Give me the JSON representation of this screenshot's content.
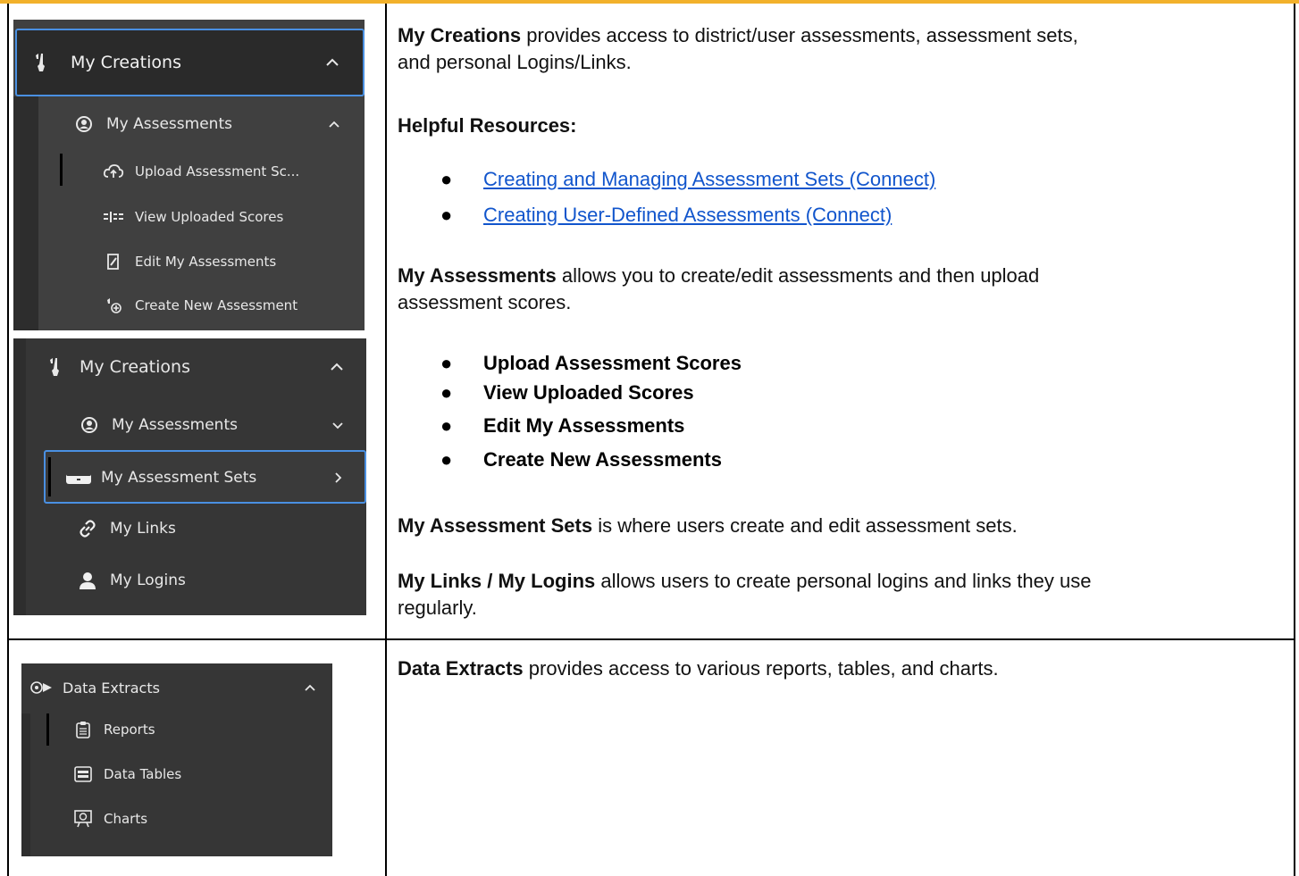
{
  "shot1": {
    "header": "My Creations",
    "header_icon": "tools-icon",
    "group": "My Assessments",
    "items": [
      {
        "label": "Upload Assessment Sc...",
        "icon": "cloud-upload-icon"
      },
      {
        "label": "View Uploaded Scores",
        "icon": "list-icon"
      },
      {
        "label": "Edit My Assessments",
        "icon": "edit-icon"
      },
      {
        "label": "Create New Assessment",
        "icon": "create-icon"
      }
    ]
  },
  "shot2": {
    "header": "My Creations",
    "items": [
      {
        "label": "My Assessments"
      },
      {
        "label": "My Assessment Sets"
      },
      {
        "label": "My Links"
      },
      {
        "label": "My Logins"
      }
    ]
  },
  "shot3": {
    "header": "Data Extracts",
    "items": [
      {
        "label": "Reports"
      },
      {
        "label": "Data Tables"
      },
      {
        "label": "Charts"
      }
    ]
  },
  "content": {
    "p1_bold": "My Creations",
    "p1_rest": " provides access to district/user assessments, assessment sets,",
    "p1_line2": "and personal Logins/Links.",
    "resources_heading": "Helpful Resources:",
    "links": [
      "Creating and Managing Assessment Sets (Connect)",
      "Creating User-Defined Assessments (Connect)"
    ],
    "p2_bold": "My Assessments",
    "p2_rest": " allows you to create/edit assessments and then upload",
    "p2_line2": "assessment scores.",
    "assessment_bullets": [
      "Upload Assessment Scores",
      "View Uploaded Scores",
      "Edit My Assessments",
      "Create New Assessments"
    ],
    "p3_bold": "My Assessment Sets",
    "p3_rest": " is where users create and edit assessment sets.",
    "p4_bold": "My Links / My Logins",
    "p4_rest": " allows users to create personal logins and links they use",
    "p4_line2": "regularly.",
    "p5_bold": "Data Extracts",
    "p5_rest": " provides access to various reports, tables, and charts."
  }
}
